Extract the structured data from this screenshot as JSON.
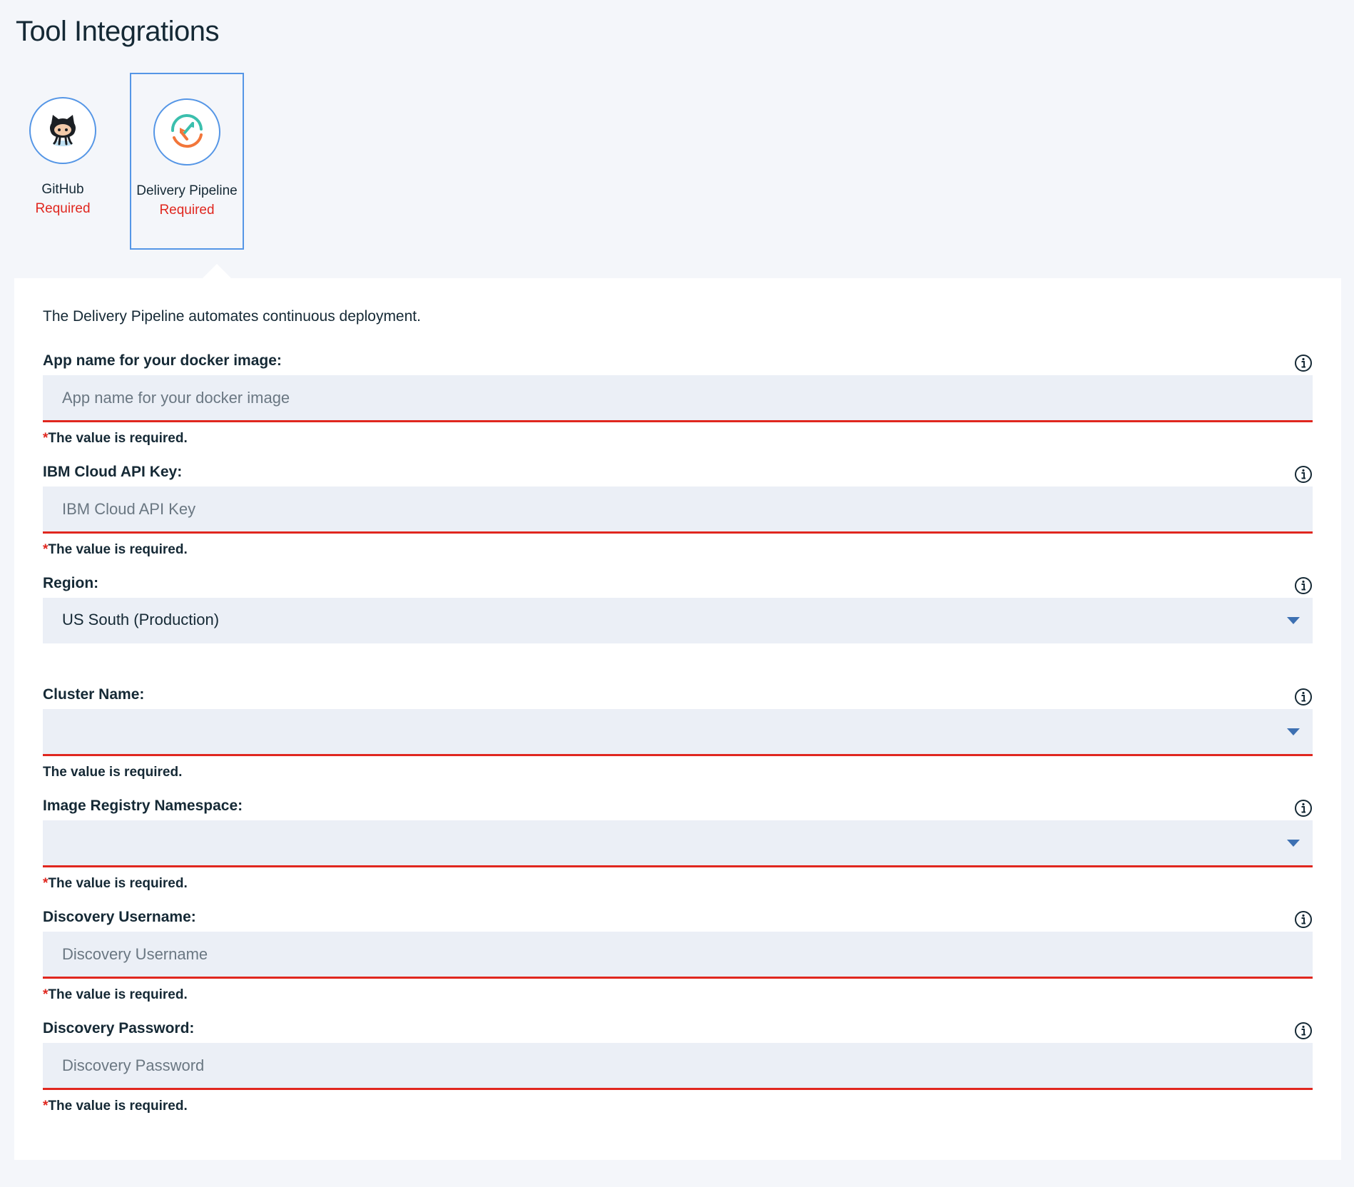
{
  "page": {
    "title": "Tool Integrations"
  },
  "tiles": [
    {
      "name": "GitHub",
      "status": "Required",
      "icon": "github-octocat-icon"
    },
    {
      "name": "Delivery Pipeline",
      "status": "Required",
      "icon": "delivery-pipeline-icon",
      "selected": true
    }
  ],
  "panel": {
    "description": "The Delivery Pipeline automates continuous deployment.",
    "error_prefix": "*",
    "error_text": "The value is required."
  },
  "fields": {
    "app_name": {
      "label": "App name for your docker image:",
      "placeholder": "App name for your docker image",
      "value": ""
    },
    "api_key": {
      "label": "IBM Cloud API Key:",
      "placeholder": "IBM Cloud API Key",
      "value": ""
    },
    "region": {
      "label": "Region:",
      "value": "US South (Production)"
    },
    "cluster_name": {
      "label": "Cluster Name:",
      "value": ""
    },
    "namespace": {
      "label": "Image Registry Namespace:",
      "value": ""
    },
    "discovery_username": {
      "label": "Discovery Username:",
      "placeholder": "Discovery Username",
      "value": ""
    },
    "discovery_password": {
      "label": "Discovery Password:",
      "placeholder": "Discovery Password",
      "value": ""
    }
  },
  "colors": {
    "accent": "#5596e6",
    "error": "#e0271f",
    "field_bg": "#ebeff6",
    "page_bg": "#f4f6fa",
    "caret": "#3d70b2"
  }
}
